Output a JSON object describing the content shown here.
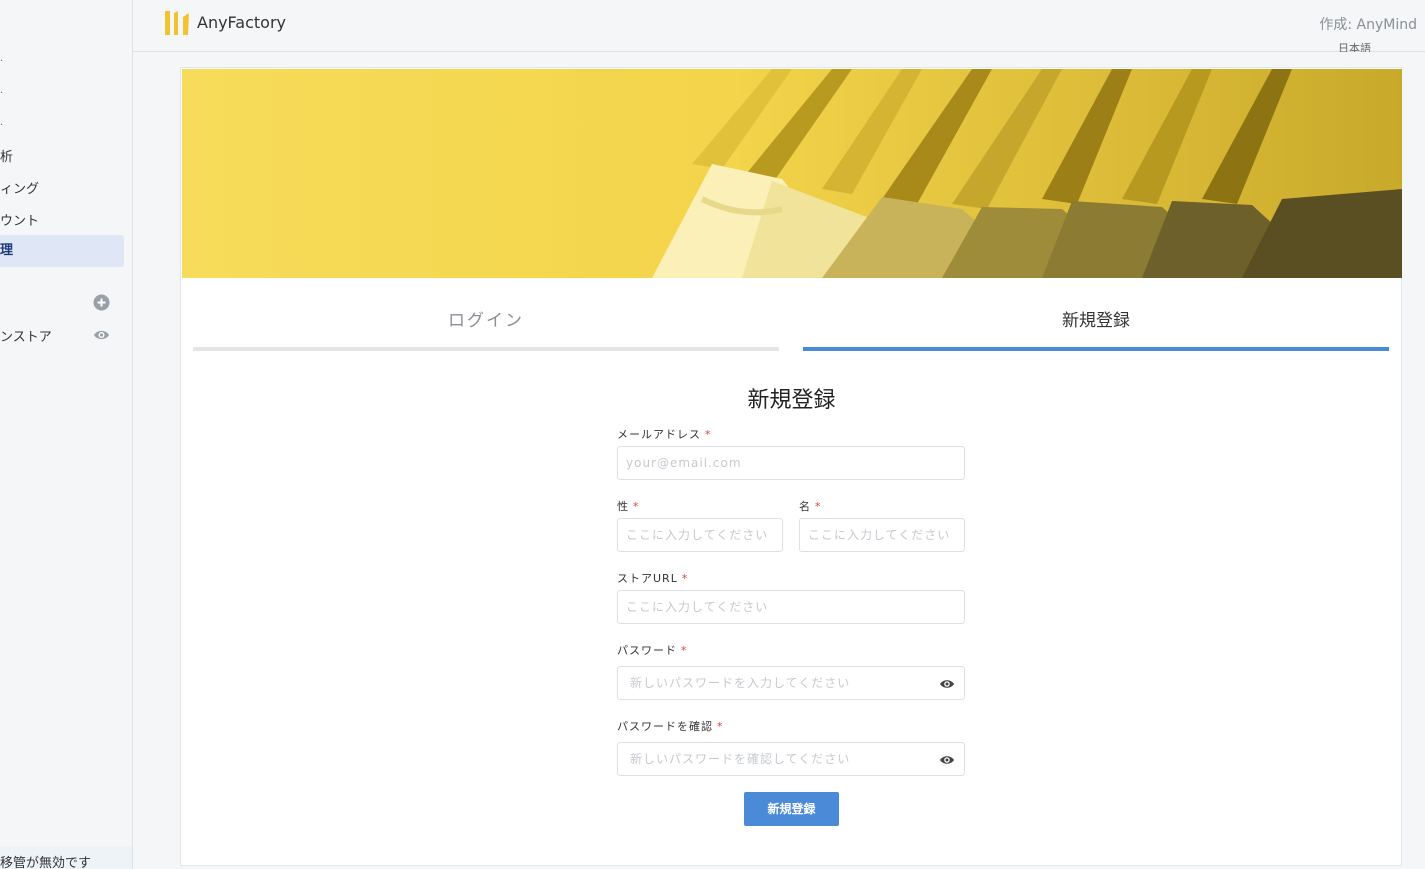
{
  "header": {
    "app_name": "AnyFactory",
    "author": "作成: AnyMind",
    "language_peek": "日本語"
  },
  "sidebar": {
    "items": [
      {
        "label": "析"
      },
      {
        "label": "ィング"
      },
      {
        "label": "ウント"
      },
      {
        "label": "理"
      }
    ],
    "store_label": "ンストア",
    "footer": "移管が無効です"
  },
  "tabs": {
    "login": "ログイン",
    "signup": "新規登録"
  },
  "form": {
    "title": "新規登録",
    "email_label": "メールアドレス",
    "email_placeholder": "your@email.com",
    "last_name_label": "性",
    "last_name_placeholder": "ここに入力してください",
    "first_name_label": "名",
    "first_name_placeholder": "ここに入力してください",
    "store_url_label": "ストアURL",
    "store_url_placeholder": "ここに入力してください",
    "password_label": "パスワード",
    "password_placeholder": "新しいパスワードを入力してください",
    "confirm_label": "パスワードを確認",
    "confirm_placeholder": "新しいパスワードを確認してください",
    "required_mark": "*",
    "submit": "新規登録"
  },
  "colors": {
    "accent": "#4a8ad6",
    "required": "#e03c3c",
    "logo": "#f2c230",
    "banner": "#f5d64a"
  }
}
